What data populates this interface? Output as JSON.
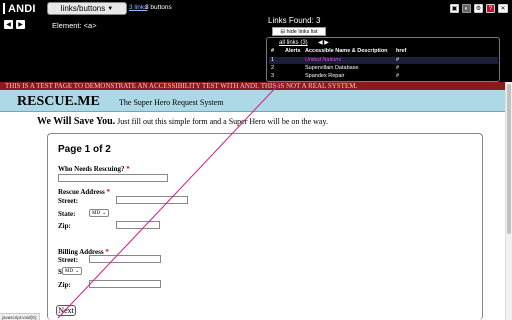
{
  "andi": {
    "logo": "ANDI",
    "mode_menu": "links/buttons",
    "links_count": "3 links",
    "buttons_count": "3 buttons",
    "element_label": "Element: <a>",
    "links_found": "Links Found: 3",
    "hide_list": "hide links list",
    "tab_all": "all links (3)",
    "table": {
      "headers": [
        "#",
        "Alerts",
        "Accessible Name & Description",
        "href"
      ],
      "rows": [
        {
          "num": "1",
          "name": "United Nations",
          "href": "#"
        },
        {
          "num": "2",
          "name": "Supervillain Database",
          "href": "#"
        },
        {
          "num": "3",
          "name": "Spandex Repair",
          "href": "#"
        }
      ]
    }
  },
  "page": {
    "banner": "THIS IS A TEST PAGE TO DEMONSTRATE AN ACCESSIBILITY TEST WITH ANDI. THIS IS NOT A REAL SYSTEM.",
    "site_title": "RESCUE.ME",
    "site_tagline": "The Super Hero Request System",
    "intro_bold": "We Will Save You.",
    "intro_text": "Just fill out this simple form and a Super Hero will be on the way.",
    "form": {
      "page_num": "Page 1 of 2",
      "who_label": "Who Needs Rescuing?",
      "rescue_address": "Rescue Address",
      "billing_address": "Billing Address",
      "required_mark": "*",
      "street": "Street:",
      "state": "State:",
      "zip": "Zip:",
      "state_value": "MD",
      "next": "Next"
    },
    "status": "javascript:void(0);"
  },
  "colors": {
    "banner_bg": "#8b1a1a",
    "header_bg": "#add8e6",
    "connector": "#d81b8f",
    "selected_link": "#d94fd9"
  }
}
